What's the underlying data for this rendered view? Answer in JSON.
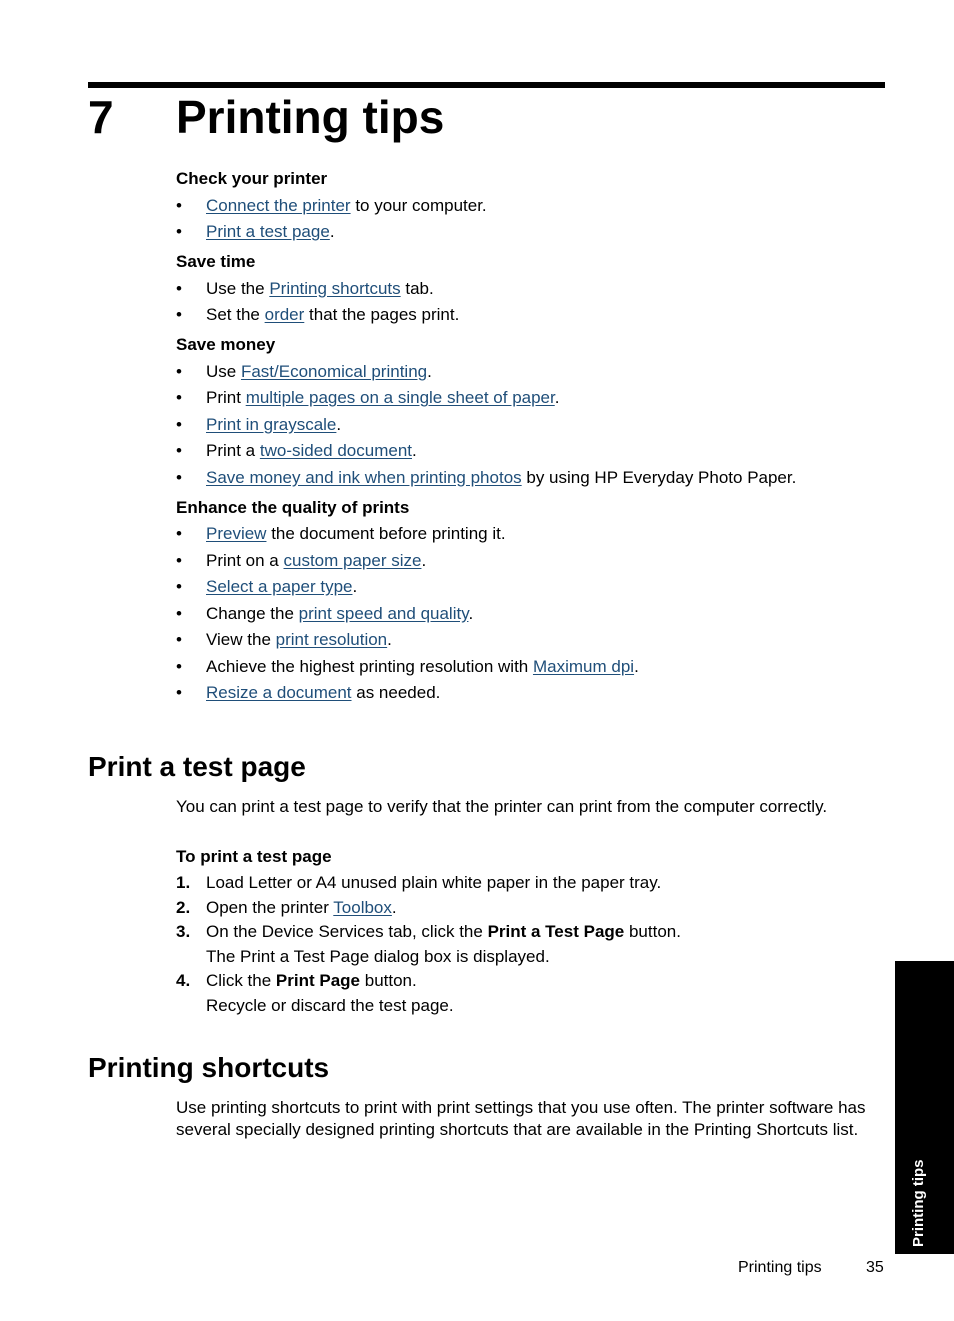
{
  "chapter": {
    "number": "7",
    "title": "Printing tips"
  },
  "tips": {
    "check_printer": {
      "heading": "Check your printer",
      "items": [
        {
          "pre": "",
          "link": "Connect the printer",
          "post": " to your computer."
        },
        {
          "pre": "",
          "link": "Print a test page",
          "post": "."
        }
      ]
    },
    "save_time": {
      "heading": "Save time",
      "items": [
        {
          "pre": "Use the ",
          "link": "Printing shortcuts",
          "post": " tab."
        },
        {
          "pre": "Set the ",
          "link": "order",
          "post": " that the pages print."
        }
      ]
    },
    "save_money": {
      "heading": "Save money",
      "items": [
        {
          "pre": "Use ",
          "link": "Fast/Economical printing",
          "post": "."
        },
        {
          "pre": "Print ",
          "link": "multiple pages on a single sheet of paper",
          "post": "."
        },
        {
          "pre": "",
          "link": "Print in grayscale",
          "post": "."
        },
        {
          "pre": "Print a ",
          "link": "two-sided document",
          "post": "."
        },
        {
          "pre": "",
          "link": "Save money and ink when printing photos",
          "post": " by using HP Everyday Photo Paper."
        }
      ]
    },
    "enhance_quality": {
      "heading": "Enhance the quality of prints",
      "items": [
        {
          "pre": "",
          "link": "Preview",
          "post": " the document before printing it."
        },
        {
          "pre": "Print on a ",
          "link": "custom paper size",
          "post": "."
        },
        {
          "pre": "",
          "link": "Select a paper type",
          "post": "."
        },
        {
          "pre": "Change the ",
          "link": "print speed and quality",
          "post": "."
        },
        {
          "pre": "View the ",
          "link": "print resolution",
          "post": "."
        },
        {
          "pre": "Achieve the highest printing resolution with ",
          "link": "Maximum dpi",
          "post": "."
        },
        {
          "pre": "",
          "link": "Resize a document",
          "post": " as needed."
        }
      ]
    },
    "bullet": "•"
  },
  "test_page": {
    "heading": "Print a test page",
    "intro": "You can print a test page to verify that the printer can print from the computer correctly.",
    "procedure_title": "To print a test page",
    "steps": [
      {
        "num": "1.",
        "pre": "Load Letter or A4 unused plain white paper in the paper tray."
      },
      {
        "num": "2.",
        "pre": "Open the printer ",
        "link": "Toolbox",
        "post": "."
      },
      {
        "num": "3.",
        "pre": "On the Device Services tab, click the ",
        "bold": "Print a Test Page",
        "post": " button.",
        "note": "The Print a Test Page dialog box is displayed."
      },
      {
        "num": "4.",
        "pre": "Click the ",
        "bold": "Print Page",
        "post": " button.",
        "note": "Recycle or discard the test page."
      }
    ]
  },
  "shortcuts": {
    "heading": "Printing shortcuts",
    "body": "Use printing shortcuts to print with print settings that you use often. The printer software has several specially designed printing shortcuts that are available in the Printing Shortcuts list."
  },
  "side_tab": {
    "label": "Printing tips"
  },
  "footer": {
    "section": "Printing tips",
    "page": "35"
  },
  "colors": {
    "link": "#1f4e79",
    "text": "#000000",
    "tab": "#000000"
  }
}
